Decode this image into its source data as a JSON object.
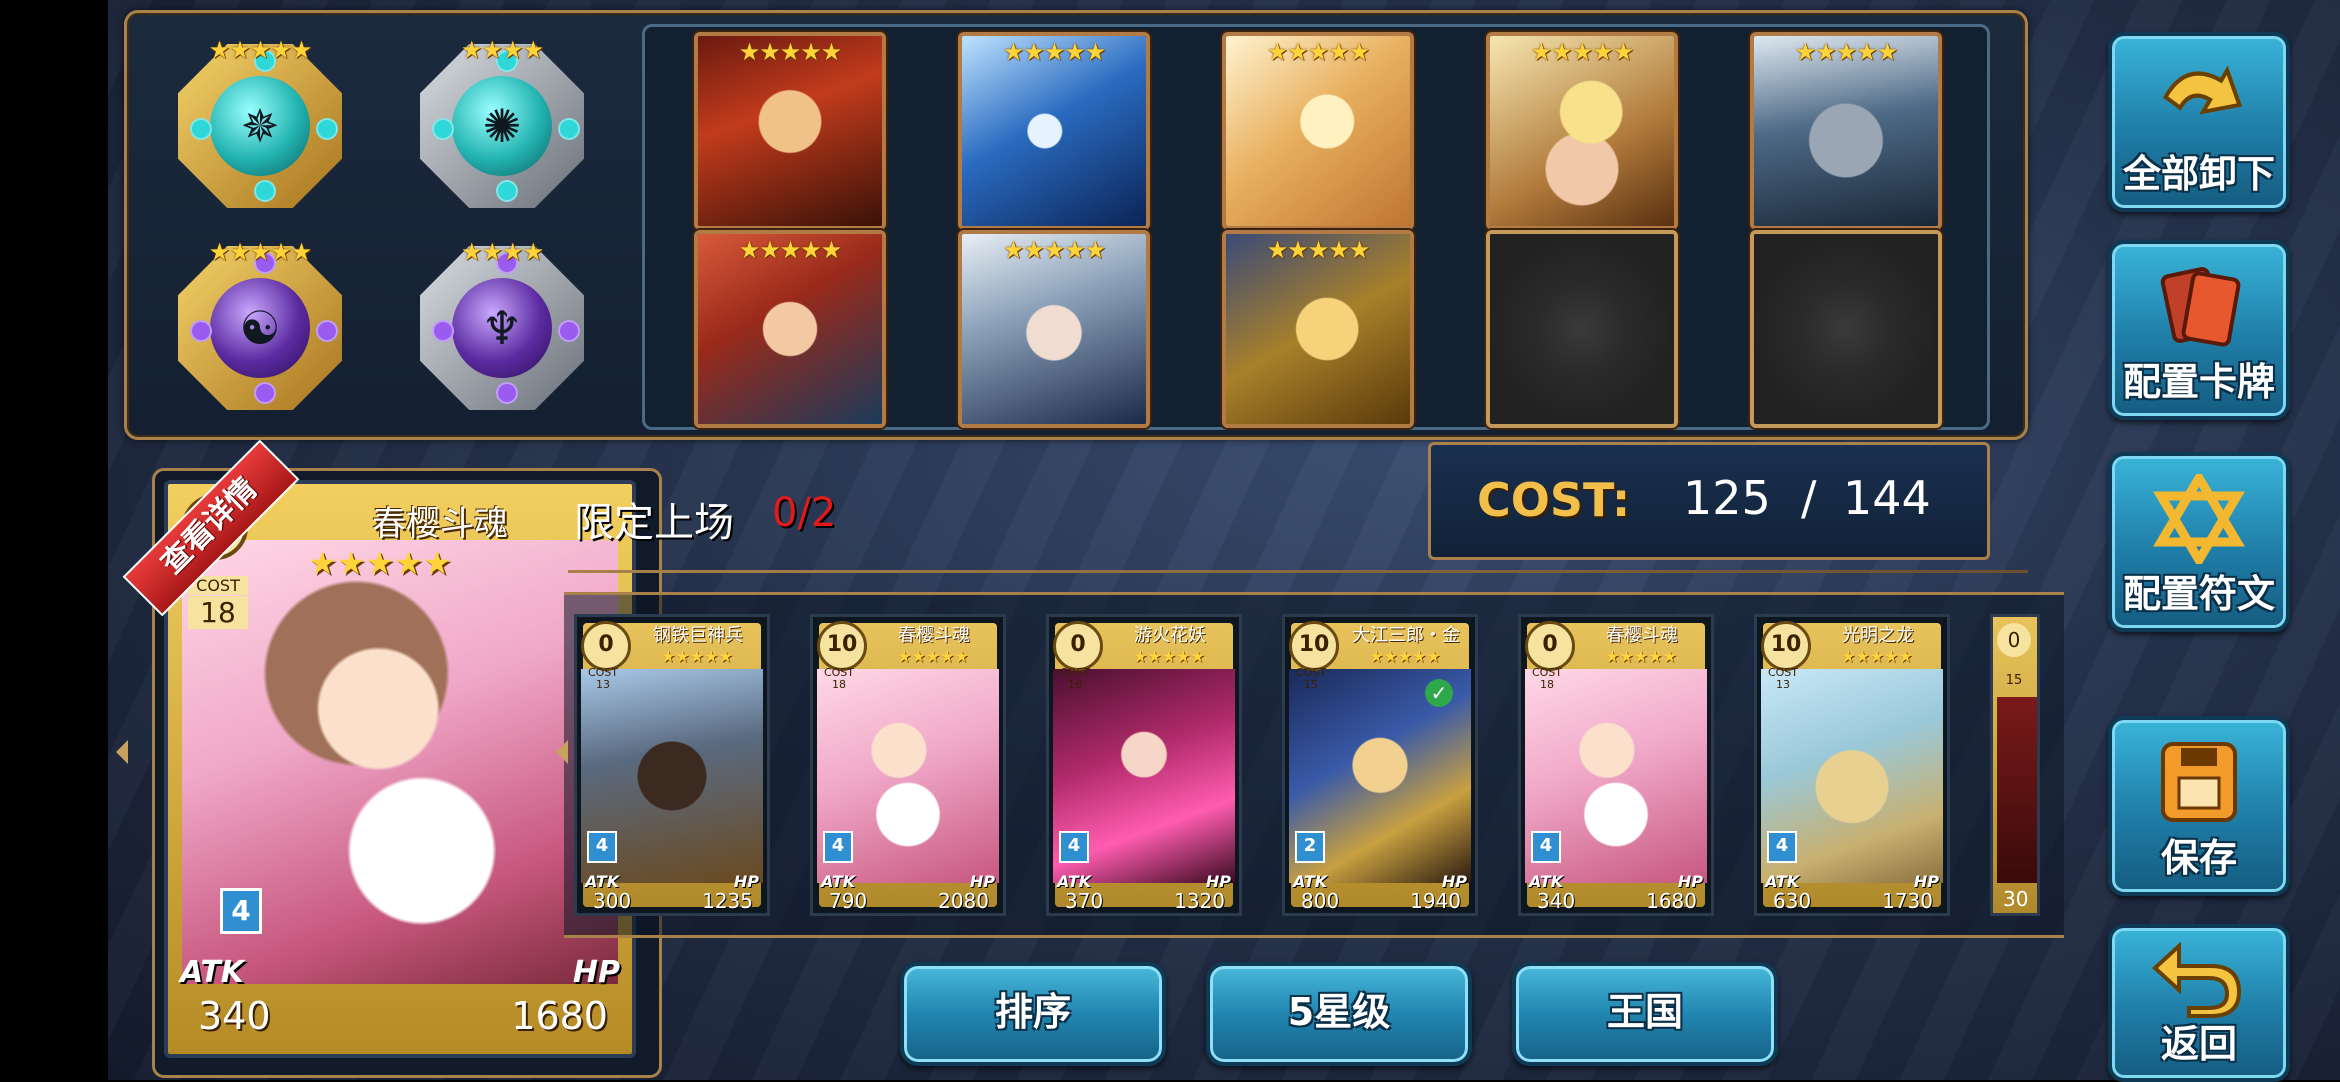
{
  "runes": [
    {
      "stars": "★★★★★",
      "icon": "compass-rune-icon",
      "color": "#22b3b0"
    },
    {
      "stars": "★★★★",
      "icon": "spiral-rune-icon",
      "color": "#22b3b0"
    },
    {
      "stars": "★★★★★",
      "icon": "yin-yang-rune-icon",
      "color": "#5b2aa0"
    },
    {
      "stars": "★★★★",
      "icon": "dragon-rune-icon",
      "color": "#5b2aa0"
    }
  ],
  "deck_cards": [
    {
      "stars": "★★★★★",
      "art": "flame-warrior"
    },
    {
      "stars": "★★★★★",
      "art": "ice-dragon"
    },
    {
      "stars": "★★★★★",
      "art": "golden-phoenix"
    },
    {
      "stars": "★★★★★",
      "art": "elf-girl"
    },
    {
      "stars": "★★★★★",
      "art": "stone-golem"
    },
    {
      "stars": "★★★★★",
      "art": "masked-girl"
    },
    {
      "stars": "★★★★★",
      "art": "white-hair-witch"
    },
    {
      "stars": "★★★★★",
      "art": "gold-dragon"
    },
    {
      "stars": "",
      "art": "empty"
    },
    {
      "stars": "",
      "art": "empty"
    }
  ],
  "side_buttons": {
    "unload_all": "全部卸下",
    "config_cards": "配置卡牌",
    "config_runes": "配置符文",
    "save": "保存",
    "back": "返回"
  },
  "selected_card": {
    "ribbon": "查看详情",
    "cost": "0",
    "cost_label": "COST",
    "cost_value": "18",
    "name": "春樱斗魂",
    "stars": "★★★★★",
    "level": "4",
    "atk_label": "ATK",
    "hp_label": "HP",
    "atk": "340",
    "hp": "1680"
  },
  "limit": {
    "label": "限定上场",
    "value": "0/2"
  },
  "cost_box": {
    "label": "COST:",
    "used": "125",
    "sep": "/",
    "max": "144"
  },
  "collection": [
    {
      "cost": "0",
      "cost_val": "13",
      "name": "钢铁巨神兵",
      "level": "4",
      "atk": "300",
      "hp": "1235"
    },
    {
      "cost": "10",
      "cost_val": "18",
      "name": "春樱斗魂",
      "level": "4",
      "atk": "790",
      "hp": "2080"
    },
    {
      "cost": "0",
      "cost_val": "16",
      "name": "游火花妖",
      "level": "4",
      "atk": "370",
      "hp": "1320"
    },
    {
      "cost": "10",
      "cost_val": "15",
      "name": "大江三郎・金",
      "level": "2",
      "atk": "800",
      "hp": "1940"
    },
    {
      "cost": "0",
      "cost_val": "18",
      "name": "春樱斗魂",
      "level": "4",
      "atk": "340",
      "hp": "1680"
    },
    {
      "cost": "10",
      "cost_val": "13",
      "name": "光明之龙",
      "level": "4",
      "atk": "630",
      "hp": "1730"
    },
    {
      "cost": "0",
      "cost_val": "15",
      "name": "",
      "level": "",
      "atk": "30",
      "hp": ""
    }
  ],
  "mini_labels": {
    "cost": "COST",
    "atk": "ATK",
    "hp": "HP",
    "stars": "★★★★★"
  },
  "filters": {
    "sort": "排序",
    "stars": "5星级",
    "kingdom": "王国"
  }
}
